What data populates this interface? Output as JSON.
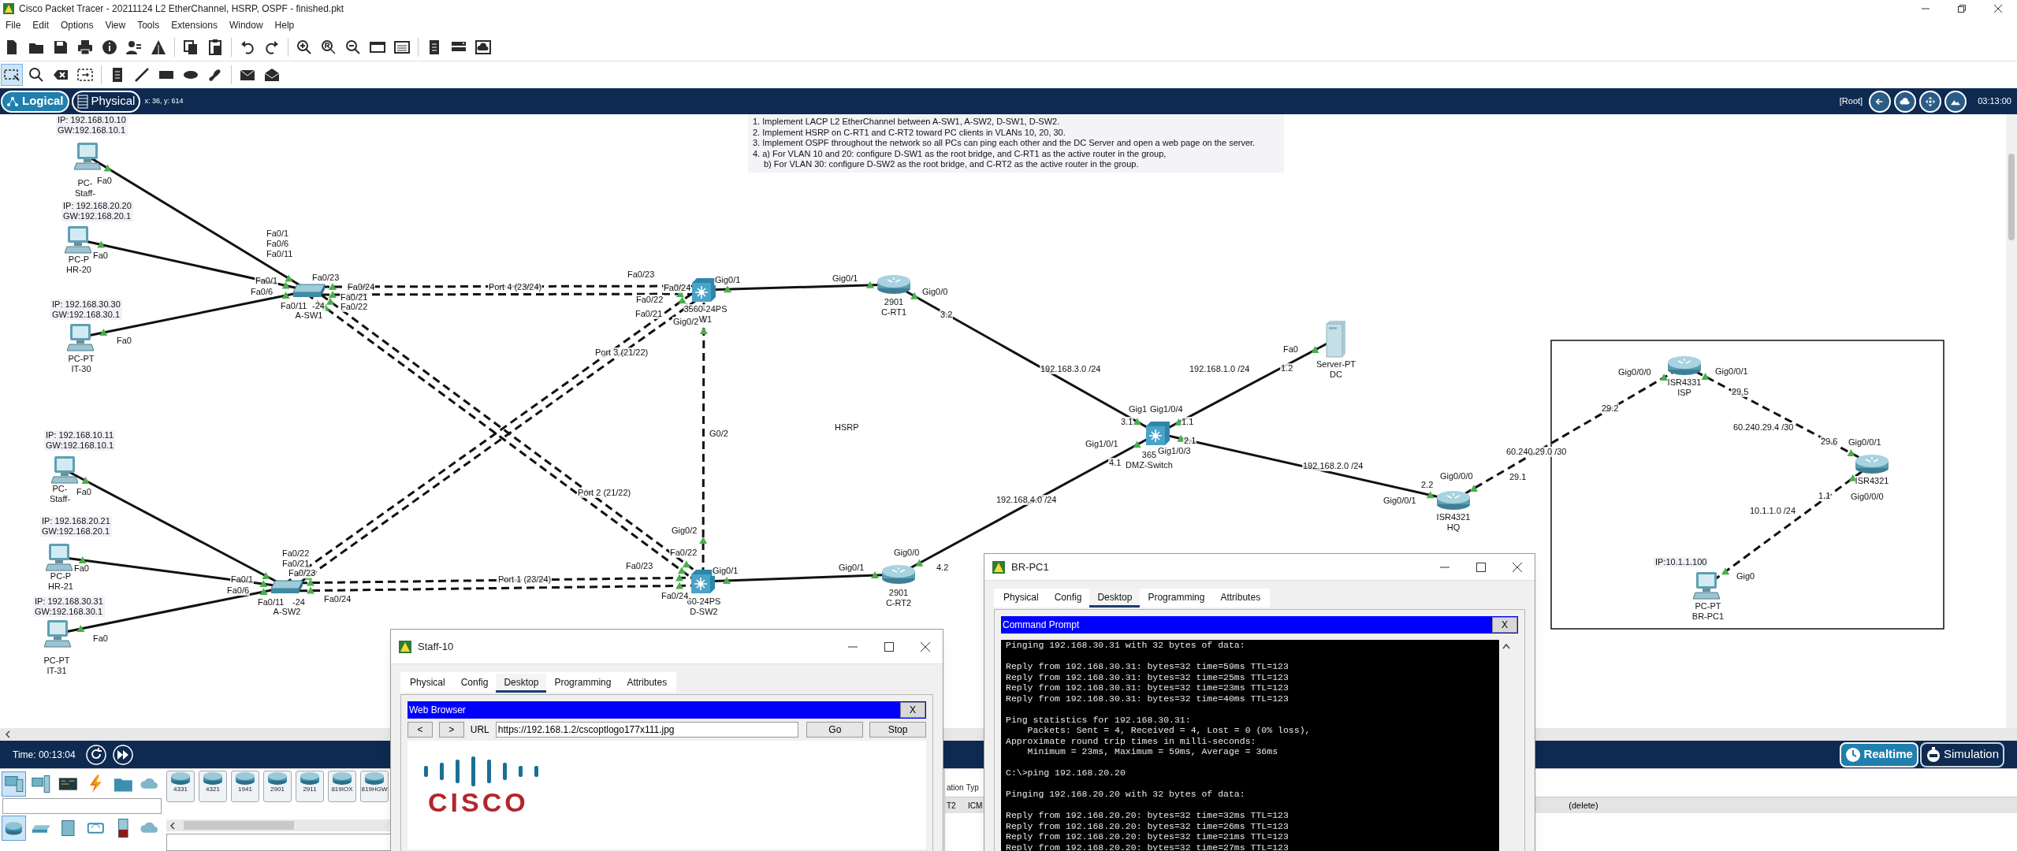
{
  "window": {
    "title": "Cisco Packet Tracer - 20211124 L2 EtherChannel, HSRP, OSPF - finished.pkt"
  },
  "menu": [
    "File",
    "Edit",
    "Options",
    "View",
    "Tools",
    "Extensions",
    "Window",
    "Help"
  ],
  "workspace_tabs": [
    {
      "label": "Logical",
      "selected": true
    },
    {
      "label": "Physical",
      "selected": false
    }
  ],
  "cursor_position": "x: 36, y: 614",
  "nav_right": {
    "root": "[Root]",
    "clock": "03:13:00"
  },
  "instructions": [
    {
      "text": "1. Implement LACP L2 EtherChannel between A-SW1, A-SW2, D-SW1, D-SW2.",
      "indented": false
    },
    {
      "text": "2. Implement HSRP on C-RT1 and C-RT2 toward PC clients in VLANs 10, 20, 30.",
      "indented": false
    },
    {
      "text": "3. Implement OSPF throughout the network so all PCs can ping each other and the DC Server and open a web page on the server.",
      "indented": false
    },
    {
      "text": "4. a) For VLAN 10 and 20: configure D-SW1 as the root bridge, and C-RT1 as the active router in the group,",
      "indented": false
    },
    {
      "text": "b) For VLAN 30: configure D-SW2 as the root bridge, and C-RT2 as the active router in the group.",
      "indented": true
    }
  ],
  "devices": [
    {
      "kind": "pc",
      "name_lines": [
        "PC-",
        "Staff-"
      ],
      "ip_note": [
        "IP: 192.168.10.10",
        "GW:192.168.10.1"
      ]
    },
    {
      "kind": "pc",
      "name_lines": [
        "PC-P",
        "HR-20"
      ],
      "ip_note": [
        "IP: 192.168.20.20",
        "GW:192.168.20.1"
      ]
    },
    {
      "kind": "pc",
      "name_lines": [
        "PC-PT",
        "IT-30"
      ],
      "ip_note": [
        "IP: 192.168.30.30",
        "GW:192.168.30.1"
      ]
    },
    {
      "kind": "switch",
      "name_lines": [
        "A-SW1"
      ]
    },
    {
      "kind": "pc",
      "name_lines": [
        "PC-",
        "Staff-"
      ],
      "ip_note": [
        "IP: 192.168.10.11",
        "GW:192.168.10.1"
      ]
    },
    {
      "kind": "pc",
      "name_lines": [
        "PC-P",
        "HR-21"
      ],
      "ip_note": [
        "IP: 192.168.20.21",
        "GW:192.168.20.1"
      ]
    },
    {
      "kind": "pc",
      "name_lines": [
        "PC-PT",
        "IT-31"
      ],
      "ip_note": [
        "IP: 192.168.30.31",
        "GW:192.168.30.1"
      ]
    },
    {
      "kind": "switch",
      "name_lines": [
        "A-SW2"
      ]
    },
    {
      "kind": "multilayer_switch",
      "name_lines": [
        "3560-24PS",
        "W1"
      ]
    },
    {
      "kind": "multilayer_switch",
      "name_lines": [
        "60-24PS",
        "D-SW2"
      ]
    },
    {
      "kind": "router",
      "name_lines": [
        "2901",
        "C-RT1"
      ]
    },
    {
      "kind": "router",
      "name_lines": [
        "2901",
        "C-RT2"
      ]
    },
    {
      "kind": "multilayer_switch",
      "name_lines": [
        "365",
        "DMZ-Switch"
      ]
    },
    {
      "kind": "server",
      "name_lines": [
        "Server-PT",
        "DC"
      ]
    },
    {
      "kind": "router",
      "name_lines": [
        "ISR4321",
        "HQ"
      ]
    },
    {
      "kind": "router",
      "name_lines": [
        "ISR4331",
        "ISP"
      ]
    },
    {
      "kind": "router",
      "name_lines": [
        "ISR4321"
      ]
    },
    {
      "kind": "pc",
      "name_lines": [
        "PC-PT",
        "BR-PC1"
      ],
      "ip_note": [
        "IP:10.1.1.100"
      ]
    }
  ],
  "interface_labels": [
    "Fa0",
    "Fa0",
    "Fa0",
    "Fa0/1",
    "Fa0/6",
    "Fa0/11",
    "Fa0/1",
    "Fa0/6",
    "Fa0/11",
    "-24",
    "Fa0/23",
    "Fa0/24",
    "Fa0/21",
    "Fa0/22",
    "Port 4 (23/24)",
    "Fa0/23",
    "Fa0/24",
    "Fa0/22",
    "Fa0/21",
    "Gig0/2",
    "Gig0/1",
    "Port 3 (21/22)",
    "G0/2",
    "Fa0",
    "Port 2 (21/22)",
    "Fa0",
    "Fa0",
    "Fa0/22",
    "Fa0/21",
    "Fa0/23",
    "Fa0/1",
    "Fa0/6",
    "Fa0/11",
    "-24",
    "Fa0/24",
    "Port 1 (23/24)",
    "Gig0/2",
    "Fa0/22",
    "Fa0/23",
    "Gig0/1",
    "Fa0/24",
    "Gig0/1",
    "Gig0/0",
    "3.2",
    "Gig0/1",
    "Gig0/0",
    "4.2",
    "192.168.3.0 /24",
    "192.168.1.0 /24",
    "192.168.2.0 /24",
    "192.168.4.0 /24",
    "Gig1",
    "Gig1/0/4",
    "3.1",
    "1.1",
    "2.1",
    "Gig1/0/1",
    "Gig1/0/3",
    "4.1",
    "Fa0",
    "1.2",
    "HSRP",
    "Gig0/0/1",
    "2.2",
    "Gig0/0/0",
    "29.1",
    "60.240.29.0 /30",
    "29.2",
    "Gig0/0/0",
    "Gig0/0/1",
    "29.5",
    "60.240.29.4 /30",
    "29.6",
    "Gig0/0/1",
    "1.1",
    "Gig0/0/0",
    "10.1.1.0 /24",
    "Gig0"
  ],
  "simulation": {
    "time": "Time: 00:13:04"
  },
  "modes": [
    {
      "label": "Realtime",
      "selected": true
    },
    {
      "label": "Simulation",
      "selected": false
    }
  ],
  "device_models": [
    "4331",
    "4321",
    "1941",
    "2901",
    "2911",
    "819IOX",
    "819HGW"
  ],
  "event_list": {
    "column_1": "ation",
    "column_2": "Typ",
    "cell_1": "T2",
    "cell_2": "ICM",
    "cell_3": "(delete)"
  },
  "staff_window": {
    "title": "Staff-10",
    "tabs": [
      {
        "label": "Physical",
        "selected": false
      },
      {
        "label": "Config",
        "selected": false
      },
      {
        "label": "Desktop",
        "selected": true
      },
      {
        "label": "Programming",
        "selected": false
      },
      {
        "label": "Attributes",
        "selected": false
      }
    ],
    "app_title": "Web Browser",
    "close": "X",
    "back": "<",
    "forward": ">",
    "url_label": "URL",
    "url": "https://192.168.1.2/cscoptlogo177x111.jpg",
    "go": "Go",
    "stop": "Stop",
    "logo_text": "CISCO"
  },
  "br_window": {
    "title": "BR-PC1",
    "tabs": [
      {
        "label": "Physical",
        "selected": false
      },
      {
        "label": "Config",
        "selected": false
      },
      {
        "label": "Desktop",
        "selected": true
      },
      {
        "label": "Programming",
        "selected": false
      },
      {
        "label": "Attributes",
        "selected": false
      }
    ],
    "app_title": "Command Prompt",
    "close": "X",
    "console_blocks": [
      [
        "Pinging 192.168.30.31 with 32 bytes of data:"
      ],
      [
        "Reply from 192.168.30.31: bytes=32 time=59ms TTL=123",
        "Reply from 192.168.30.31: bytes=32 time=25ms TTL=123",
        "Reply from 192.168.30.31: bytes=32 time=23ms TTL=123",
        "Reply from 192.168.30.31: bytes=32 time=40ms TTL=123"
      ],
      [
        "Ping statistics for 192.168.30.31:",
        "    Packets: Sent = 4, Received = 4, Lost = 0 (0% loss),",
        "Approximate round trip times in milli-seconds:",
        "    Minimum = 23ms, Maximum = 59ms, Average = 36ms"
      ],
      [
        "C:\\>ping 192.168.20.20"
      ],
      [
        "Pinging 192.168.20.20 with 32 bytes of data:"
      ],
      [
        "Reply from 192.168.20.20: bytes=32 time=32ms TTL=123",
        "Reply from 192.168.20.20: bytes=32 time=26ms TTL=123",
        "Reply from 192.168.20.20: bytes=32 time=21ms TTL=123",
        "Reply from 192.168.20.20: bytes=32 time=27ms TTL=123"
      ]
    ]
  }
}
